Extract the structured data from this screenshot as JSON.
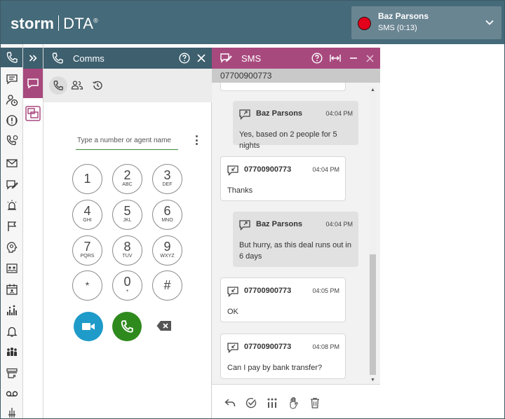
{
  "header": {
    "logo_storm": "storm",
    "logo_dta": "DTA",
    "logo_reg": "®",
    "user_name": "Baz Parsons",
    "user_status": "SMS  (0:13)",
    "status_color": "#e3001b"
  },
  "colors": {
    "header_bg": "#456a79",
    "teal": "#3d5f6e",
    "sms_accent": "#a8497e",
    "video_button": "#1e9bc8",
    "call_button": "#2f8a1e"
  },
  "rail": {
    "icons": [
      "phone-icon",
      "chat-icon",
      "agent-status-icon",
      "alert-icon",
      "call-history-icon",
      "email-icon",
      "sms-edit-icon",
      "alarm-icon",
      "flag-icon",
      "reporting-icon",
      "contacts-icon",
      "calendar-icon",
      "stats-icon",
      "notification-icon",
      "team-icon",
      "queue-icon",
      "voicemail-icon",
      "settings-icon"
    ]
  },
  "comms": {
    "title": "Comms",
    "search_placeholder": "Type a number or agent name",
    "keypad": [
      {
        "digit": "1",
        "letters": ""
      },
      {
        "digit": "2",
        "letters": "ABC"
      },
      {
        "digit": "3",
        "letters": "DEF"
      },
      {
        "digit": "4",
        "letters": "GHI"
      },
      {
        "digit": "5",
        "letters": "JKL"
      },
      {
        "digit": "6",
        "letters": "MNO"
      },
      {
        "digit": "7",
        "letters": "PQRS"
      },
      {
        "digit": "8",
        "letters": "TUV"
      },
      {
        "digit": "9",
        "letters": "WXYZ"
      },
      {
        "digit": "*",
        "letters": ""
      },
      {
        "digit": "0",
        "letters": "+"
      },
      {
        "digit": "#",
        "letters": ""
      }
    ]
  },
  "sms": {
    "title": "SMS",
    "number": "07700900773",
    "messages": [
      {
        "direction": "out",
        "sender": "Baz Parsons",
        "time": "04:04 PM",
        "text": "Yes, based on 2 people for 5 nights"
      },
      {
        "direction": "in",
        "sender": "07700900773",
        "time": "04:04 PM",
        "text": "Thanks"
      },
      {
        "direction": "out",
        "sender": "Baz Parsons",
        "time": "04:04 PM",
        "text": "But hurry, as this deal runs out in 6 days"
      },
      {
        "direction": "in",
        "sender": "07700900773",
        "time": "04:05 PM",
        "text": "OK"
      },
      {
        "direction": "in",
        "sender": "07700900773",
        "time": "04:08 PM",
        "text": "Can I pay by bank transfer?"
      }
    ],
    "footer_icons": [
      "reply-icon",
      "check-circle-icon",
      "transfer-icon",
      "hold-hand-icon",
      "trash-icon"
    ]
  }
}
